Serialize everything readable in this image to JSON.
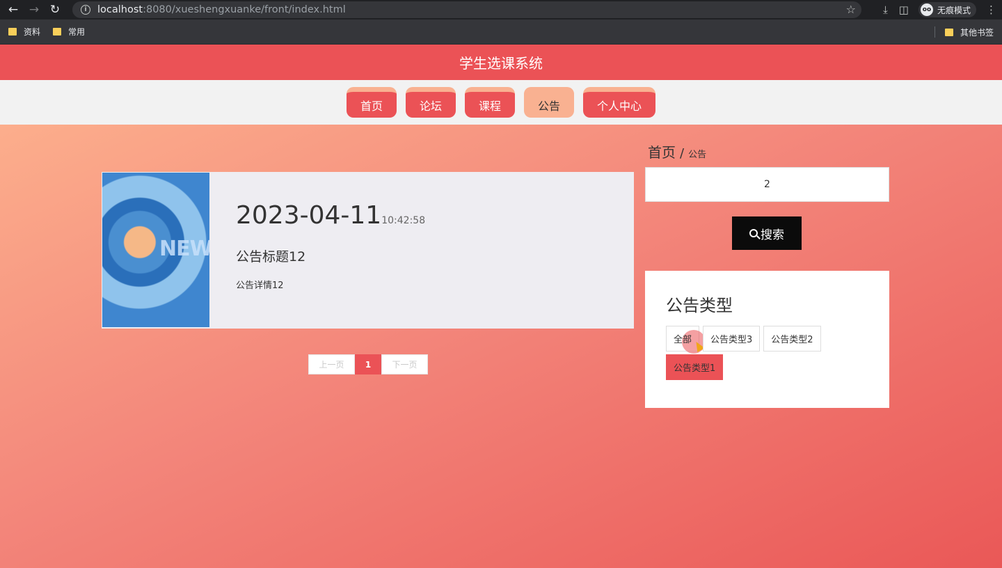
{
  "browser": {
    "url_host": "localhost",
    "url_rest": ":8080/xueshengxuanke/front/index.html",
    "incognito_label": "无痕模式",
    "bookmarks": [
      "资料",
      "常用"
    ],
    "bookmarks_right": "其他书签"
  },
  "site": {
    "title": "学生选课系统",
    "nav": [
      "首页",
      "论坛",
      "课程",
      "公告",
      "个人中心"
    ],
    "active_nav": "公告"
  },
  "notice": {
    "date": "2023-04-11",
    "time": "10:42:58",
    "title": "公告标题12",
    "detail": "公告详情12",
    "image_text": "NEWS"
  },
  "pager": {
    "prev": "上一页",
    "current": "1",
    "next": "下一页"
  },
  "breadcrumb": {
    "home": "首页",
    "sep": "/",
    "current": "公告"
  },
  "search": {
    "value": "2",
    "button": "搜索"
  },
  "types": {
    "title": "公告类型",
    "items": [
      "全部",
      "公告类型3",
      "公告类型2",
      "公告类型1"
    ],
    "active": "公告类型1"
  },
  "colors": {
    "primary": "#eb5256",
    "accent": "#f9b191"
  }
}
